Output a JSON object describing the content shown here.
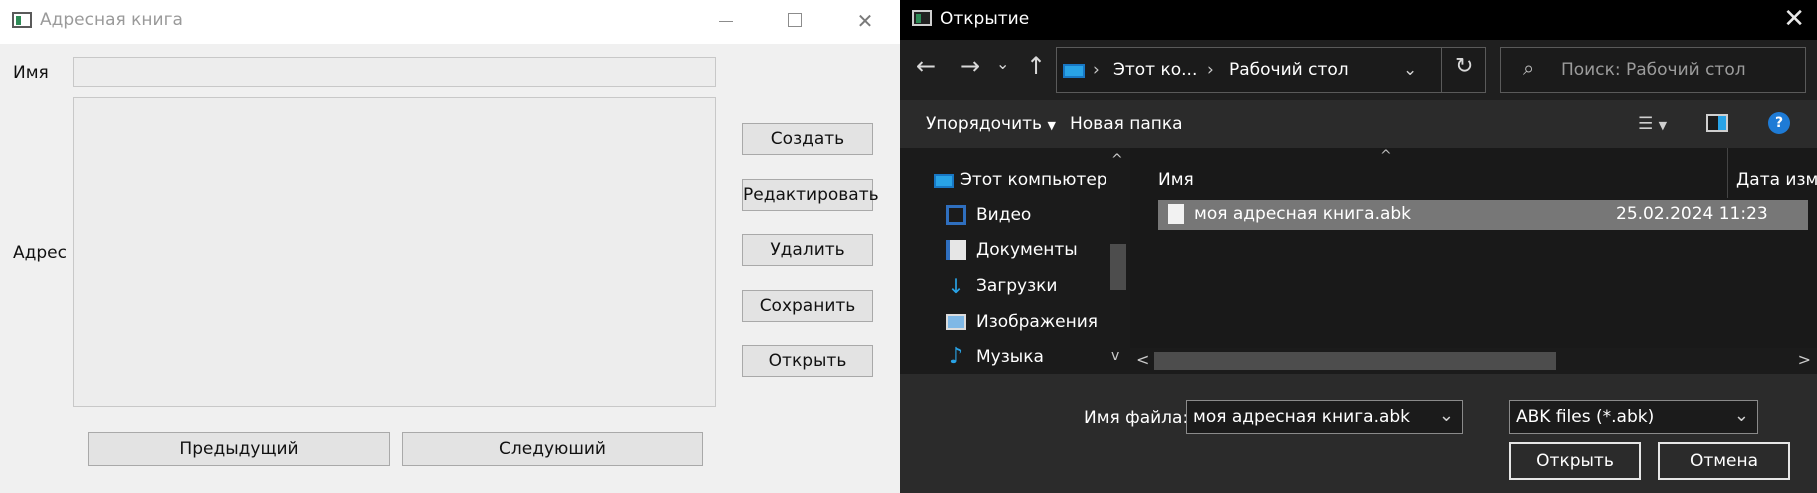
{
  "addressbook": {
    "title": "Адресная книга",
    "name_label": "Имя",
    "address_label": "Адрес",
    "buttons": {
      "create": "Создать",
      "edit": "Редактировать",
      "delete": "Удалить",
      "save": "Сохранить",
      "open": "Открыть",
      "prev": "Предыдущий",
      "next": "Следуюший"
    }
  },
  "dialog": {
    "title": "Открытие",
    "breadcrumb": [
      "Этот ко...",
      "Рабочий стол"
    ],
    "search_placeholder": "Поиск: Рабочий стол",
    "toolbar": {
      "organize": "Упорядочить",
      "new_folder": "Новая папка"
    },
    "nav_items": [
      {
        "label": "Этот компьютер",
        "icon": "computer-icon"
      },
      {
        "label": "Видео",
        "icon": "video-folder-icon"
      },
      {
        "label": "Документы",
        "icon": "documents-folder-icon"
      },
      {
        "label": "Загрузки",
        "icon": "downloads-folder-icon"
      },
      {
        "label": "Изображения",
        "icon": "pictures-folder-icon"
      },
      {
        "label": "Музыка",
        "icon": "music-folder-icon"
      }
    ],
    "columns": {
      "name": "Имя",
      "date": "Дата изменения"
    },
    "files": [
      {
        "name": "моя адресная книга.abk",
        "date": "25.02.2024 11:23"
      }
    ],
    "filename_label": "Имя файла:",
    "filename_value": "моя адресная книга.abk",
    "filetype_value": "ABK files (*.abk)",
    "open_button": "Открыть",
    "cancel_button": "Отмена"
  }
}
